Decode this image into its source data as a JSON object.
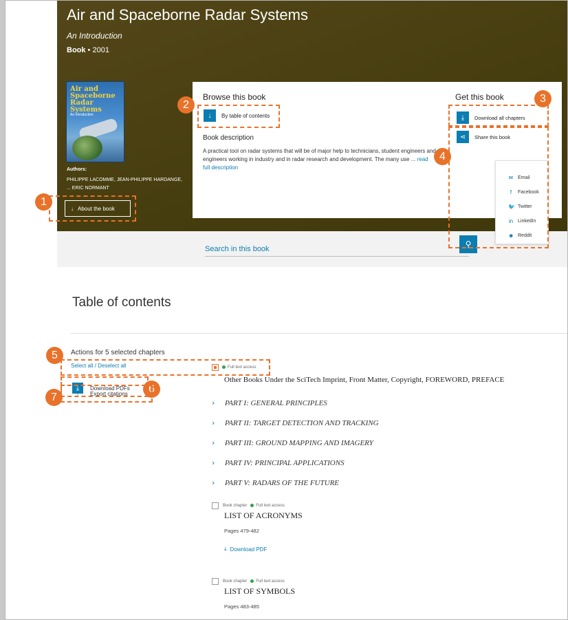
{
  "book": {
    "title": "Air and Spaceborne Radar Systems",
    "subtitle": "An Introduction",
    "type": "Book",
    "year": "2001",
    "cover": {
      "title": "Air and Spaceborne Radar Systems",
      "subtitle": "An Introduction"
    },
    "authors_label": "Authors:",
    "authors": "PHILIPPE LACOMME, JEAN-PHILIPPE HARDANGE, ... ERIC NORMANT",
    "about_button": "About the book"
  },
  "browse": {
    "heading": "Browse this book",
    "toc_button": "By table of contents",
    "description_heading": "Book description",
    "description": "A practical tool on radar systems that will be of major help to technicians, student engineers and engineers working in industry and in radar research and development. The many use ...",
    "read_more": "read full description"
  },
  "get": {
    "heading": "Get this book",
    "download_all": "Download all chapters",
    "share": "Share this book"
  },
  "share_menu": [
    {
      "label": "Email",
      "icon": "email-icon",
      "glyph": "✉"
    },
    {
      "label": "Facebook",
      "icon": "facebook-icon",
      "glyph": "f"
    },
    {
      "label": "Twitter",
      "icon": "twitter-icon",
      "glyph": "🐦"
    },
    {
      "label": "LinkedIn",
      "icon": "linkedin-icon",
      "glyph": "in"
    },
    {
      "label": "Reddit",
      "icon": "reddit-icon",
      "glyph": "☻"
    }
  ],
  "search": {
    "placeholder": "Search in this book"
  },
  "toc": {
    "title": "Table of contents",
    "actions_heading": "Actions for 5 selected chapters",
    "select_all": "Select all / Deselect all",
    "download_pdfs": "Download PDFs",
    "export_citations": "Export citations",
    "first_entry": {
      "access": "Full text access",
      "title": "Other Books Under the SciTech Imprint, Front Matter, Copyright, FOREWORD, PREFACE"
    },
    "parts": [
      "PART I: GENERAL PRINCIPLES",
      "PART II: TARGET DETECTION AND TRACKING",
      "PART III: GROUND MAPPING AND IMAGERY",
      "PART IV: PRINCIPAL APPLICATIONS",
      "PART V: RADARS OF THE FUTURE"
    ],
    "chapters": [
      {
        "type": "Book chapter",
        "access": "Full text access",
        "title": "LIST OF ACRONYMS",
        "pages": "Pages 479-482",
        "download": "Download PDF"
      },
      {
        "type": "Book chapter",
        "access": "Full text access",
        "title": "LIST OF SYMBOLS",
        "pages": "Pages 483-485"
      }
    ]
  },
  "annotations": [
    "1",
    "2",
    "3",
    "4",
    "5",
    "6",
    "7"
  ],
  "colors": {
    "accent": "#0c7db0",
    "annotation": "#e8722a",
    "banner": "#4a4011",
    "access_dot": "#2ea24a"
  }
}
